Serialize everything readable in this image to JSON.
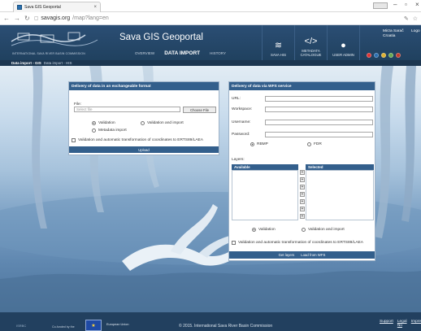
{
  "browser": {
    "tab_title": "Sava GIS Geoportal",
    "url_host": "savagis.org",
    "url_path": "/map?lang=en"
  },
  "header": {
    "site_title": "Sava GIS Geoportal",
    "commission": "INTERNATIONAL SAVA RIVER BASIN COMMISSION",
    "nav": [
      "OVERVIEW",
      "DATA IMPORT",
      "HISTORY"
    ],
    "tools": [
      {
        "label": "SAVA HIS",
        "icon": "river-icon"
      },
      {
        "label": "METADATA CATALOGUE",
        "icon": "code-icon"
      },
      {
        "label": "USER ADMIN",
        "icon": "user-icon"
      }
    ],
    "user_name": "Mirza Sarač",
    "user_country": "Croatia",
    "logout": "Logo",
    "lang_flags": [
      "#d33",
      "#2a6fb0",
      "#e0b22f",
      "#6aa84f",
      "#c0392b"
    ]
  },
  "subbar": {
    "title": "Data import - GIS",
    "crumb": "Data import - HIS"
  },
  "exchangeable": {
    "title": "Delivery of data in an exchangeable format",
    "file_label": "File:",
    "file_placeholder": "Select file",
    "choose_file": "Choose File",
    "radio_validation": "Validation",
    "radio_validation_import": "Validation and import",
    "radio_metadata": "Metadata import",
    "checkbox_transform": "Validation and automatic transformation of coordinates to ERTS89/LAEA",
    "upload": "Upload"
  },
  "wfs": {
    "title": "Delivery of data via WFS service",
    "url_label": "URL:",
    "workspace_label": "Workspace:",
    "username_label": "Username:",
    "password_label": "Password:",
    "radio_rbmp": "RBMP",
    "radio_fdr": "FDR",
    "layers_label": "Layers:",
    "available": "Available",
    "selected": "Selected",
    "radio_validation": "Validation",
    "radio_validation_import": "Validation and import",
    "checkbox_transform": "Validation and automatic transformation of coordinates to ERTS89/LAEA",
    "get_layers": "Get layers",
    "load_from_wfs": "Load from WFS"
  },
  "footer": {
    "copyright": "© 2015. International Sava River Basin Commission",
    "funded": "Co-funded by the",
    "eu_text": "European Union",
    "links": [
      "Support",
      "Legal No",
      "Impre"
    ],
    "logo_text": "ISRBC"
  }
}
